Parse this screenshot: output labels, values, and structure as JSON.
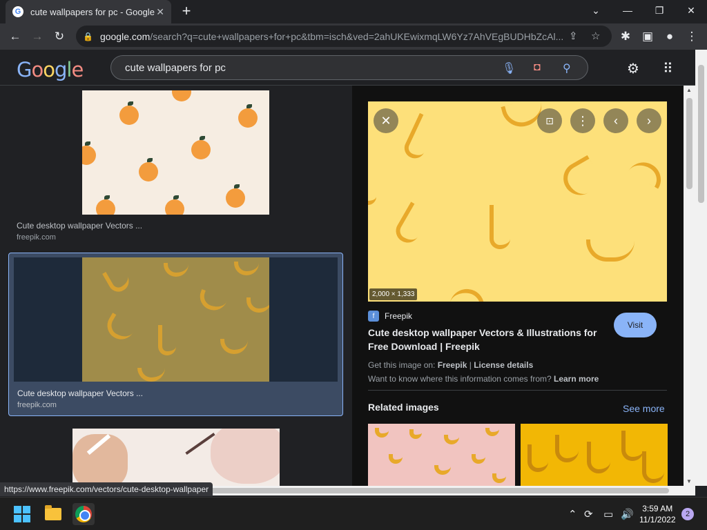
{
  "browser": {
    "tab_title": "cute wallpapers for pc - Google Search",
    "favicon_letter": "G",
    "url_host": "google.com",
    "url_rest": "/search?q=cute+wallpapers+for+pc&tbm=isch&ved=2ahUKEwixmqLW6Yz7AhVEgBUDHbZcAl...",
    "status_url": "https://www.freepik.com/vectors/cute-desktop-wallpaper"
  },
  "search": {
    "logo": "Google",
    "query": "cute wallpapers for pc"
  },
  "results": [
    {
      "title": "Cute desktop wallpaper Vectors ...",
      "source": "freepik.com"
    },
    {
      "title": "Cute desktop wallpaper Vectors ...",
      "source": "freepik.com"
    }
  ],
  "preview": {
    "dimensions": "2,000 × 1,333",
    "source_name": "Freepik",
    "title": "Cute desktop wallpaper Vectors & Illustrations for Free Download | Freepik",
    "visit_label": "Visit",
    "get_image_prefix": "Get this image on: ",
    "get_image_site": "Freepik",
    "separator": " | ",
    "license_label": "License details",
    "know_where": "Want to know where this information comes from? ",
    "learn_more": "Learn more",
    "related_title": "Related images",
    "see_more": "See more"
  },
  "taskbar": {
    "time": "3:59 AM",
    "date": "11/1/2022",
    "notification_count": "2"
  },
  "colors": {
    "accent_blue": "#8ab4f8",
    "banana_yellow": "#fde07a",
    "selected_card": "#3c4b63"
  }
}
